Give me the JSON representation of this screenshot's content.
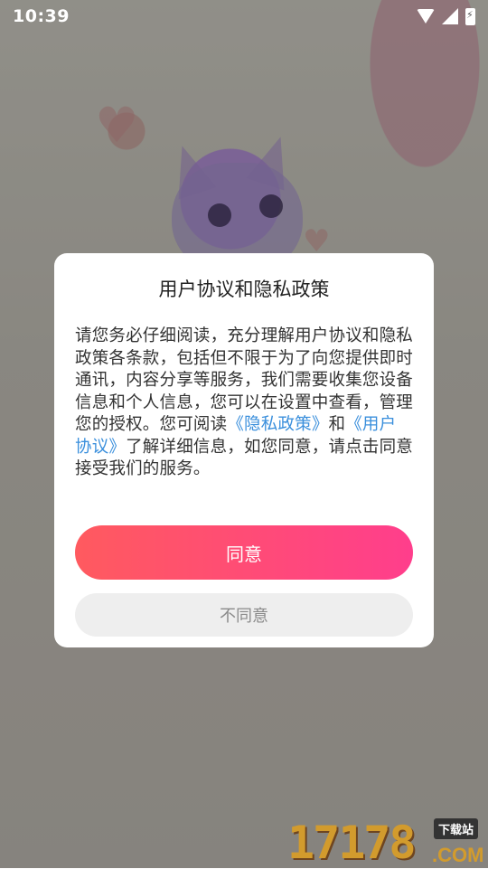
{
  "status_bar": {
    "time": "10:39"
  },
  "dialog": {
    "title": "用户协议和隐私政策",
    "body_text_1": "请您务必仔细阅读，充分理解用户协议和隐私政策各条款，包括但不限于为了向您提供即时通讯，内容分享等服务，我们需要收集您设备信息和个人信息，您可以在设置中查看，管理您的授权。您可阅读",
    "privacy_link": "《隐私政策》",
    "and_text": "和",
    "user_agreement_link": "《用户协议》",
    "body_text_2": "了解详细信息，如您同意，请点击同意接受我们的服务。",
    "agree_label": "同意",
    "disagree_label": "不同意"
  },
  "watermark": {
    "digits": "17178",
    "dotcom": ".COM",
    "tag": "下载站"
  },
  "colors": {
    "accent_gradient_start": "#ff5a5f",
    "accent_gradient_end": "#ff3e8c",
    "link": "#3a8fdc"
  }
}
